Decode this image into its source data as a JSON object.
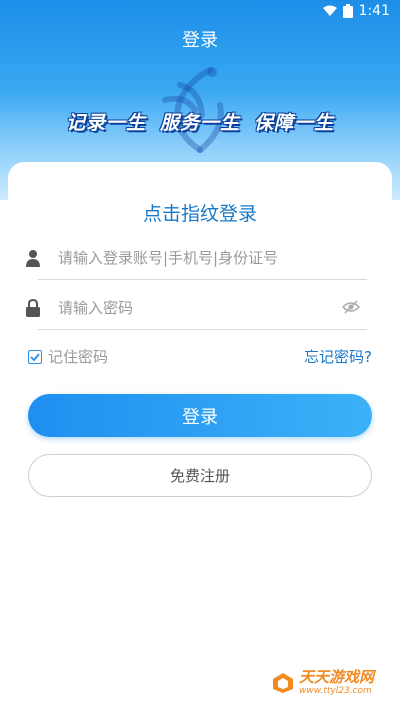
{
  "status_bar": {
    "time": "1:41",
    "icons": [
      "wifi-icon",
      "battery-icon"
    ]
  },
  "header": {
    "title": "登录",
    "slogans": [
      "记录一生",
      "服务一生",
      "保障一生"
    ]
  },
  "login": {
    "fingerprint_title": "点击指纹登录",
    "account_placeholder": "请输入登录账号|手机号|身份证号",
    "password_placeholder": "请输入密码",
    "remember_label": "记住密码",
    "remember_checked": true,
    "forgot_label": "忘记密码?",
    "login_button": "登录",
    "register_button": "免费注册"
  },
  "watermark": {
    "main": "天天游戏网",
    "sub": "www.ttyl23.com"
  },
  "colors": {
    "accent": "#1e8ff0",
    "link": "#1778c9",
    "slogan_outline": "#0b3f9a",
    "watermark": "#f28a22"
  }
}
